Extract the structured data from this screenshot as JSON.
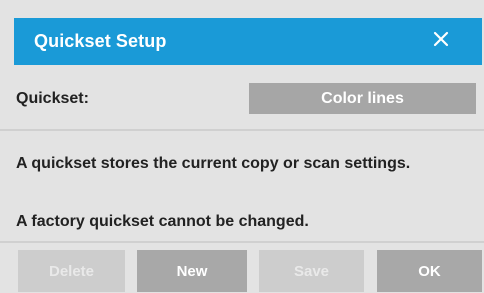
{
  "dialog": {
    "title": "Quickset Setup",
    "close_icon": "close-icon"
  },
  "quickset": {
    "label": "Quickset:",
    "selected_value": "Color lines"
  },
  "info": {
    "line1": "A quickset stores the current copy or scan settings.",
    "line2": "A factory quickset cannot be changed."
  },
  "buttons": {
    "delete": "Delete",
    "new": "New",
    "save": "Save",
    "ok": "OK"
  },
  "colors": {
    "titlebar": "#1a9ad7",
    "background": "#e3e3e3",
    "button_active": "#a8a8a8",
    "button_disabled": "#cdcdcd"
  }
}
